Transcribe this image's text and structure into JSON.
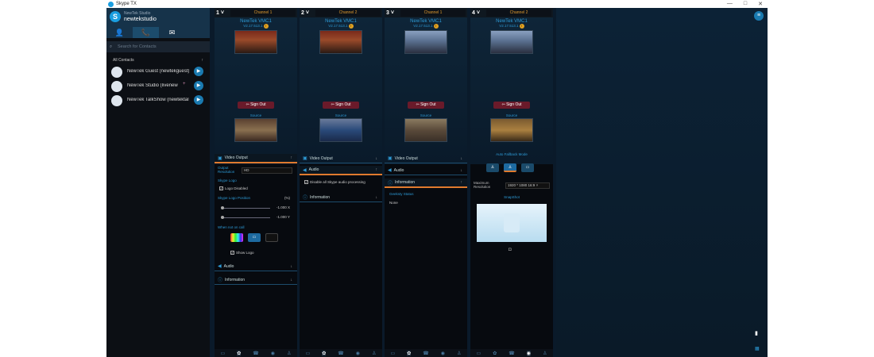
{
  "window": {
    "title": "Skype TX"
  },
  "profile": {
    "subtitle": "NewTek Studio",
    "name": "newtekstudio"
  },
  "search": {
    "placeholder": "Search for Contacts"
  },
  "contacts": {
    "header": "All Contacts",
    "items": [
      {
        "name": "NewTek Guest (newtekguest)"
      },
      {
        "name": "NewTek Studio (livenew"
      },
      {
        "name": "NewTek TalkShow (newtektal"
      }
    ]
  },
  "channels": [
    {
      "num": "1",
      "title": "Channel 1",
      "vmc": "NewTek VMC1",
      "ver": "V2.17.513.1",
      "signout": "Sign Out",
      "source": "Source"
    },
    {
      "num": "2",
      "title": "Channel 2",
      "vmc": "NewTek VMC1",
      "ver": "V2.17.513.1",
      "signout": "Sign Out",
      "source": "Source"
    },
    {
      "num": "3",
      "title": "Channel 1",
      "vmc": "NewTek VMC1",
      "ver": "V2.17.513.1",
      "signout": "Sign Out",
      "source": "Source"
    },
    {
      "num": "4",
      "title": "Channel 2",
      "vmc": "NewTek VMC1",
      "ver": "V2.17.513.1",
      "signout": "Sign Out",
      "source": "Source"
    }
  ],
  "ch1": {
    "video_output": "Video Output",
    "output_resolution_label": "Output Resolution",
    "output_resolution": "HD",
    "skype_logo_label": "Skype Logo",
    "logo_disabled": "Logo Disabled",
    "logo_position_label": "Skype Logo Position",
    "logo_position_unit": "(%)",
    "x_val": "-1.000 X",
    "y_val": "-1.000 Y",
    "when_not_on_call": "When not on call",
    "show_logo": "Show Logo",
    "audio": "Audio",
    "information": "Information"
  },
  "ch2": {
    "video_output": "Video Output",
    "audio": "Audio",
    "disable_audio": "Disable all Skype audio processing",
    "information": "Information"
  },
  "ch3": {
    "video_output": "Video Output",
    "audio": "Audio",
    "information": "Information",
    "geekstats": "Geeksty Status",
    "none": "None"
  },
  "ch4": {
    "auto_fallback": "Auto Fallback Mode",
    "max_res_label": "Maximum Resolution",
    "max_res": "1920 * 1080",
    "aspect": "16:9",
    "snapshot": "SnapShot"
  }
}
